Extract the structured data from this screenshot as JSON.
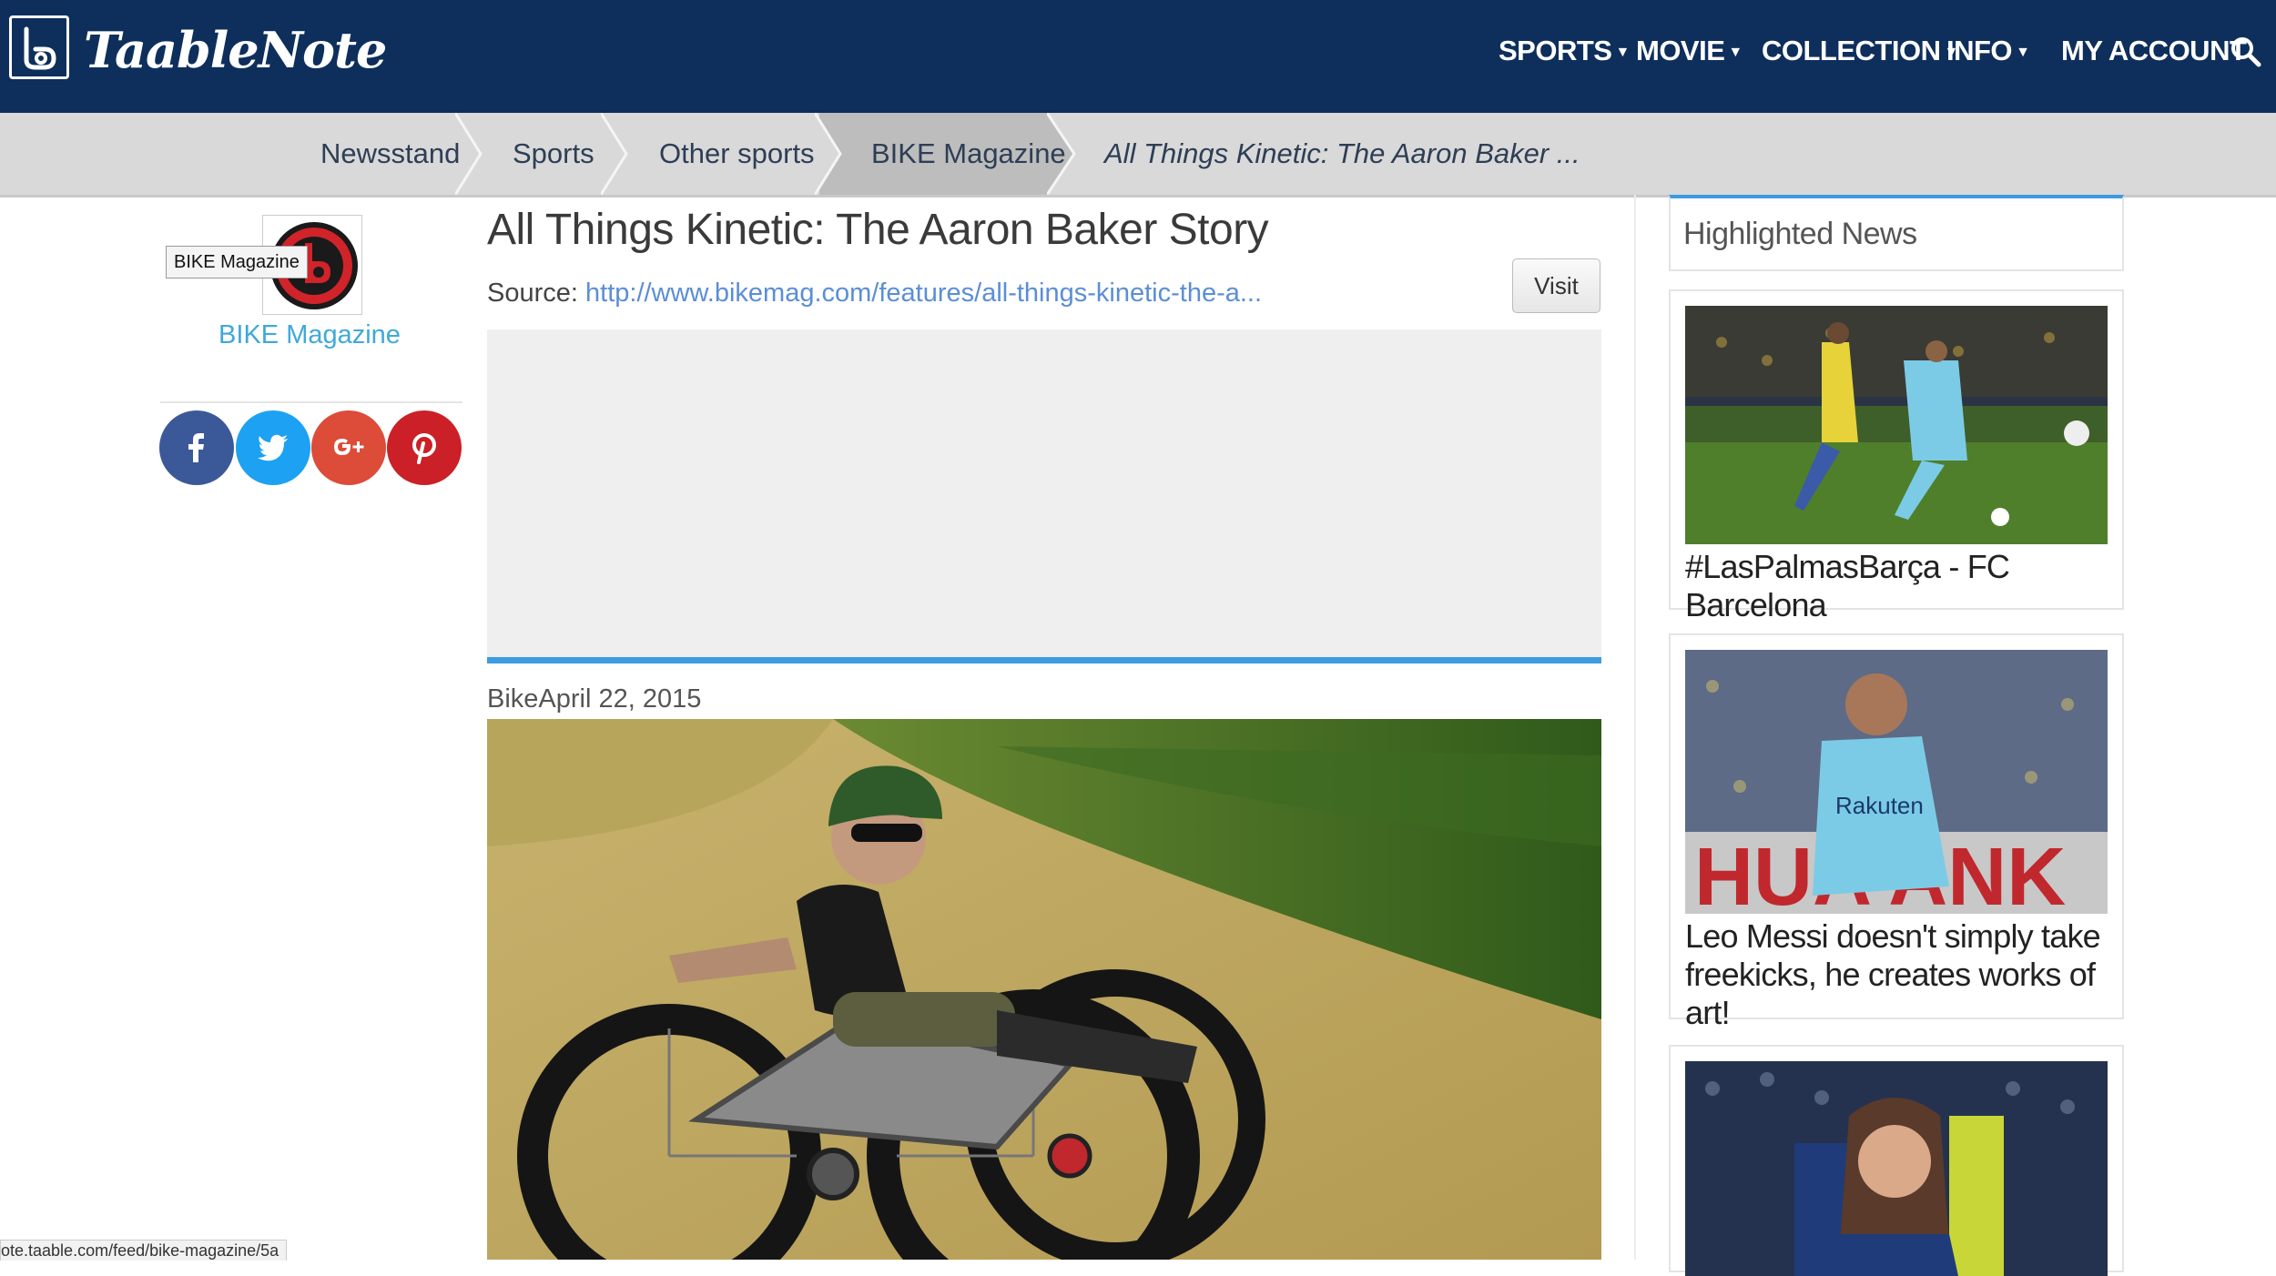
{
  "header": {
    "brand": "TaableNote",
    "nav": [
      {
        "label": "SPORTS",
        "dropdown": true
      },
      {
        "label": "MOVIE",
        "dropdown": true
      },
      {
        "label": "COLLECTION",
        "dropdown": true
      },
      {
        "label": "INFO",
        "dropdown": true
      },
      {
        "label": "MY ACCOUNT",
        "dropdown": false
      }
    ],
    "search_icon": "search-icon"
  },
  "breadcrumb": [
    "Newsstand",
    "Sports",
    "Other sports",
    "BIKE Magazine",
    "All Things Kinetic: The Aaron Baker ..."
  ],
  "source": {
    "tooltip": "BIKE Magazine",
    "name": "BIKE Magazine",
    "social": [
      "facebook-icon",
      "twitter-icon",
      "google-plus-icon",
      "pinterest-icon"
    ]
  },
  "article": {
    "title": "All Things Kinetic: The Aaron Baker Story",
    "source_label": "Source:",
    "source_url": "http://www.bikemag.com/features/all-things-kinetic-the-a...",
    "visit_label": "Visit",
    "dateline": "BikeApril 22, 2015"
  },
  "sidebar": {
    "heading": "Highlighted News",
    "news": [
      {
        "caption": "#LasPalmasBarça - FC Barcelona"
      },
      {
        "caption": "Leo Messi doesn't simply take freekicks, he creates works of art!"
      },
      {
        "caption": ""
      }
    ]
  },
  "status_bar": "ote.taable.com/feed/bike-magazine/5a",
  "colors": {
    "navbar": "#0e2f5c",
    "accent": "#3d9be0",
    "link": "#5b8ed6",
    "source_name": "#3fa9d9",
    "facebook": "#3b5998",
    "twitter": "#1da1f2",
    "google_plus": "#dd4b39",
    "pinterest": "#cb2027"
  }
}
